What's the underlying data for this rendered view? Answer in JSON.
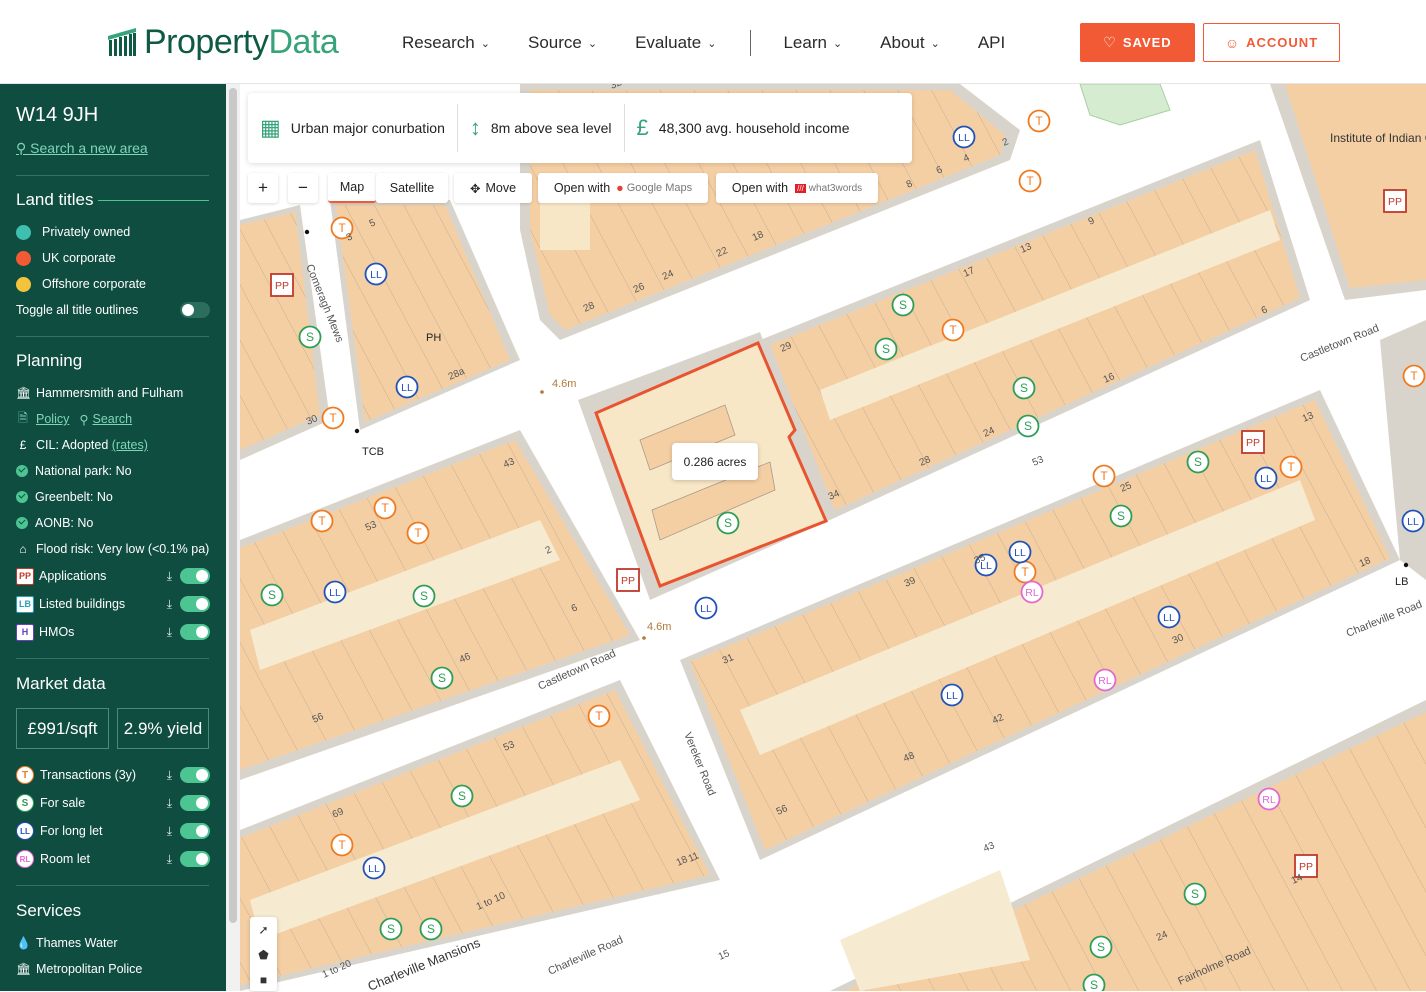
{
  "header": {
    "logo_left": "Property",
    "logo_right": "Data",
    "nav": [
      {
        "label": "Research",
        "has_menu": true
      },
      {
        "label": "Source",
        "has_menu": true
      },
      {
        "label": "Evaluate",
        "has_menu": true
      },
      {
        "label": "Learn",
        "has_menu": true
      },
      {
        "label": "About",
        "has_menu": true
      },
      {
        "label": "API",
        "has_menu": false
      }
    ],
    "saved_label": "SAVED",
    "account_label": "ACCOUNT",
    "accent_color": "#f15a35",
    "brand_color": "#0f5a45"
  },
  "sidebar": {
    "postcode": "W14 9JH",
    "search_link": "Search a new area",
    "land_titles": {
      "heading": "Land titles",
      "items": [
        {
          "label": "Privately owned",
          "color": "#3fbfb0"
        },
        {
          "label": "UK corporate",
          "color": "#f15a35"
        },
        {
          "label": "Offshore corporate",
          "color": "#f3c43b"
        }
      ],
      "toggle_label": "Toggle all title outlines",
      "toggle_on": false
    },
    "planning": {
      "heading": "Planning",
      "council": "Hammersmith and Fulham",
      "policy_link": "Policy",
      "search_link": "Search",
      "cil_label": "CIL: Adopted",
      "cil_link": "(rates)",
      "national_park": "National park: No",
      "greenbelt": "Greenbelt: No",
      "aonb": "AONB: No",
      "flood": "Flood risk: Very low (<0.1% pa)",
      "layers": [
        {
          "badge": "PP",
          "label": "Applications",
          "on": true
        },
        {
          "badge": "LB",
          "label": "Listed buildings",
          "on": true
        },
        {
          "badge": "H",
          "label": "HMOs",
          "on": true
        }
      ]
    },
    "market": {
      "heading": "Market data",
      "price": "£991/sqft",
      "yield": "2.9% yield",
      "layers": [
        {
          "badge": "T",
          "label": "Transactions (3y)",
          "on": true
        },
        {
          "badge": "S",
          "label": "For sale",
          "on": true
        },
        {
          "badge": "LL",
          "label": "For long let",
          "on": true
        },
        {
          "badge": "RL",
          "label": "Room let",
          "on": true
        }
      ]
    },
    "services": {
      "heading": "Services",
      "items": [
        "Thames Water",
        "Metropolitan Police"
      ]
    }
  },
  "info": {
    "settlement": "Urban major conurbation",
    "elevation": "8m above sea level",
    "income": "48,300 avg. household income"
  },
  "map_controls": {
    "zoom_in": "+",
    "zoom_out": "−",
    "map": "Map",
    "satellite": "Satellite",
    "move": "Move",
    "open_with_1": "Open with",
    "google_maps": "Google Maps",
    "open_with_2": "Open with",
    "what3words": "what3words"
  },
  "map": {
    "selection_area": "0.286 acres",
    "labels": {
      "castletown_road_1": "Castletown Road",
      "castletown_road_2": "Castletown Road",
      "charleville_road_1": "Charleville Road",
      "charleville_road_2": "Charleville Road",
      "vereker_road": "Vereker Road",
      "comeragh_mews": "Comeragh Mews",
      "fairholme_road": "Fairholme Road",
      "charleville_mansions": "Charleville Mansions",
      "institute": "Institute of Indian Culture",
      "ph": "PH",
      "tcb": "TCB",
      "lb": "LB",
      "spot_height_1": "4.6m",
      "spot_height_2": "4.6m"
    },
    "house_numbers": [
      "32",
      "4",
      "2",
      "6",
      "8",
      "26",
      "24",
      "22",
      "18",
      "17",
      "13",
      "9",
      "6",
      "28",
      "29",
      "3",
      "5",
      "28a",
      "30",
      "16",
      "24",
      "28",
      "34",
      "25",
      "13",
      "43",
      "53",
      "53",
      "2",
      "46",
      "6",
      "56",
      "31",
      "35",
      "39",
      "42",
      "48",
      "56",
      "30",
      "18",
      "43",
      "14",
      "24",
      "69",
      "53",
      "18",
      "1 to 10",
      "1 to 20",
      "11",
      "15"
    ],
    "markers": {
      "T": "T",
      "S": "S",
      "LL": "LL",
      "RL": "RL",
      "PP": "PP"
    }
  }
}
